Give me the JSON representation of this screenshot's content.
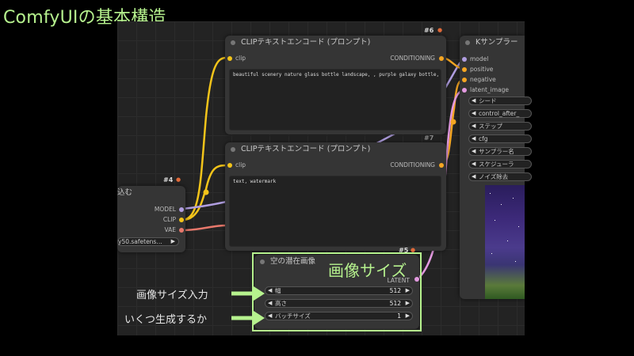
{
  "slide": {
    "title": "ComfyUIの基本構造",
    "callout_size": "画像サイズ",
    "annotation_size_input": "画像サイズ入力",
    "annotation_count": "いくつ生成するか"
  },
  "colors": {
    "accent": "#b6f28e",
    "clip_wire": "#f3c41a",
    "conditioning_wire": "#f5a623",
    "model_wire": "#b09ee0",
    "vae_wire": "#e8786b",
    "latent_wire": "#e39ae0"
  },
  "nodes": {
    "loader": {
      "id_label": "#4",
      "title": "込む",
      "outputs": [
        "MODEL",
        "CLIP",
        "VAE"
      ],
      "ckpt_value": "y50.safetens…"
    },
    "clip_pos": {
      "id_label": "#6",
      "title": "CLIPテキストエンコード (プロンプト)",
      "input": "clip",
      "output": "CONDITIONING",
      "text": "beautiful scenery nature glass bottle landscape, , purple galaxy bottle,"
    },
    "clip_neg": {
      "id_label": "#7",
      "title": "CLIPテキストエンコード (プロンプト)",
      "input": "clip",
      "output": "CONDITIONING",
      "text": "text, watermark"
    },
    "latent": {
      "id_label": "#5",
      "title": "空の潜在画像",
      "output": "LATENT",
      "widgets": [
        {
          "label": "幅",
          "value": "512"
        },
        {
          "label": "高さ",
          "value": "512"
        },
        {
          "label": "バッチサイズ",
          "value": "1"
        }
      ]
    },
    "ksampler": {
      "title": "Kサンプラー",
      "inputs": [
        "model",
        "positive",
        "negative",
        "latent_image"
      ],
      "widgets": [
        "シード",
        "control_after_",
        "ステップ",
        "cfg",
        "サンプラー名",
        "スケジューラ",
        "ノイズ除去"
      ]
    }
  }
}
